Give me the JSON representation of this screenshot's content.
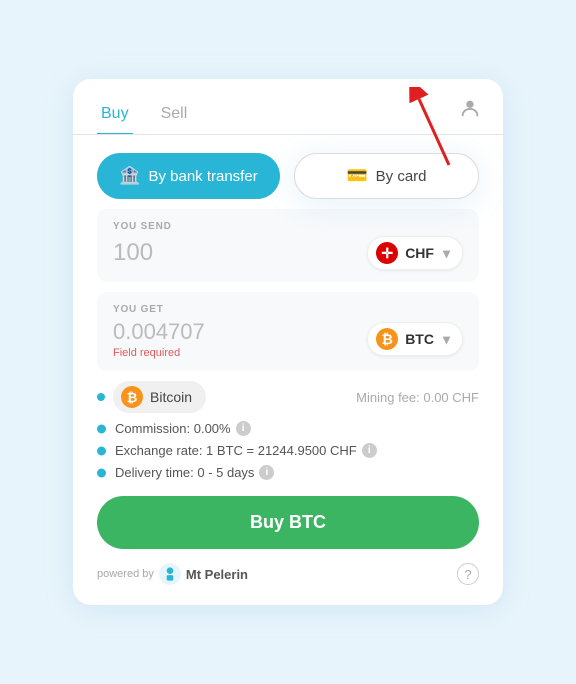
{
  "tabs": {
    "buy": "Buy",
    "sell": "Sell"
  },
  "methods": {
    "bank": "By bank transfer",
    "card": "By card"
  },
  "send_section": {
    "label": "YOU SEND",
    "amount": "100",
    "currency": "CHF"
  },
  "get_section": {
    "label": "YOU GET",
    "amount": "0.004707",
    "currency": "BTC",
    "error": "Field required"
  },
  "coin_row": {
    "name": "Bitcoin",
    "mining_fee": "Mining fee: 0.00 CHF"
  },
  "info_rows": {
    "commission": "Commission: 0.00%",
    "exchange_rate": "Exchange rate: 1 BTC = 21244.9500 CHF",
    "delivery_time": "Delivery time: 0 - 5 days"
  },
  "buy_button": "Buy BTC",
  "footer": {
    "powered_by": "powered by",
    "brand": "Mt\nPelerin"
  }
}
